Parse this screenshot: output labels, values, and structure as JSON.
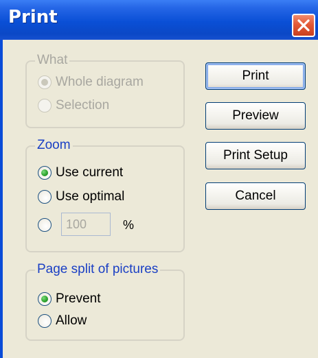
{
  "window": {
    "title": "Print"
  },
  "what_group": {
    "legend": "What",
    "options": [
      {
        "label": "Whole diagram",
        "checked": true
      },
      {
        "label": "Selection",
        "checked": false
      }
    ]
  },
  "zoom_group": {
    "legend": "Zoom",
    "options": [
      {
        "label": "Use current",
        "checked": true
      },
      {
        "label": "Use optimal",
        "checked": false
      }
    ],
    "custom_value": "100",
    "percent_symbol": "%"
  },
  "split_group": {
    "legend": "Page split of pictures",
    "options": [
      {
        "label": "Prevent",
        "checked": true
      },
      {
        "label": "Allow",
        "checked": false
      }
    ]
  },
  "buttons": {
    "print": "Print",
    "preview": "Preview",
    "print_setup": "Print Setup",
    "cancel": "Cancel"
  },
  "colors": {
    "titlebar": "#0a4fd6",
    "dialog_background": "#ece9d8",
    "group_legend_text": "#1a3fc4",
    "disabled_text": "#a8a7a0",
    "radio_checked": "#2fa52f",
    "close_button": "#e45a38"
  },
  "icons": {
    "close": "close-x-icon"
  }
}
